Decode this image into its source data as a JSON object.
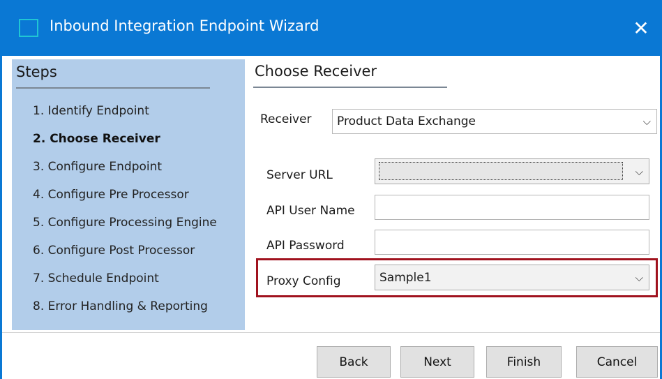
{
  "window": {
    "title": "Inbound Integration Endpoint Wizard",
    "close_glyph": "✕",
    "icon": "window-app-icon"
  },
  "steps": {
    "header": "Steps",
    "items": [
      {
        "label": "1. Identify Endpoint",
        "active": false
      },
      {
        "label": "2. Choose Receiver",
        "active": true
      },
      {
        "label": "3. Configure Endpoint",
        "active": false
      },
      {
        "label": "4. Configure Pre Processor",
        "active": false
      },
      {
        "label": "5. Configure Processing Engine",
        "active": false
      },
      {
        "label": "6. Configure Post Processor",
        "active": false
      },
      {
        "label": "7. Schedule Endpoint",
        "active": false
      },
      {
        "label": "8. Error Handling & Reporting",
        "active": false
      }
    ]
  },
  "content": {
    "title": "Choose Receiver",
    "receiver": {
      "label": "Receiver",
      "value": "Product Data Exchange"
    },
    "server_url": {
      "label": "Server URL",
      "value": ""
    },
    "api_user_name": {
      "label": "API User Name",
      "value": ""
    },
    "api_password": {
      "label": "API Password",
      "value": ""
    },
    "proxy_config": {
      "label": "Proxy Config",
      "value": "Sample1"
    },
    "dropdown_glyph": "⌵"
  },
  "buttons": {
    "back": "Back",
    "next": "Next",
    "finish": "Finish",
    "cancel": "Cancel"
  },
  "colors": {
    "titlebar": "#0a78d4",
    "steps_panel": "#b2cdea",
    "highlight_border": "#a0121e",
    "button_bg": "#e1e1e1"
  }
}
